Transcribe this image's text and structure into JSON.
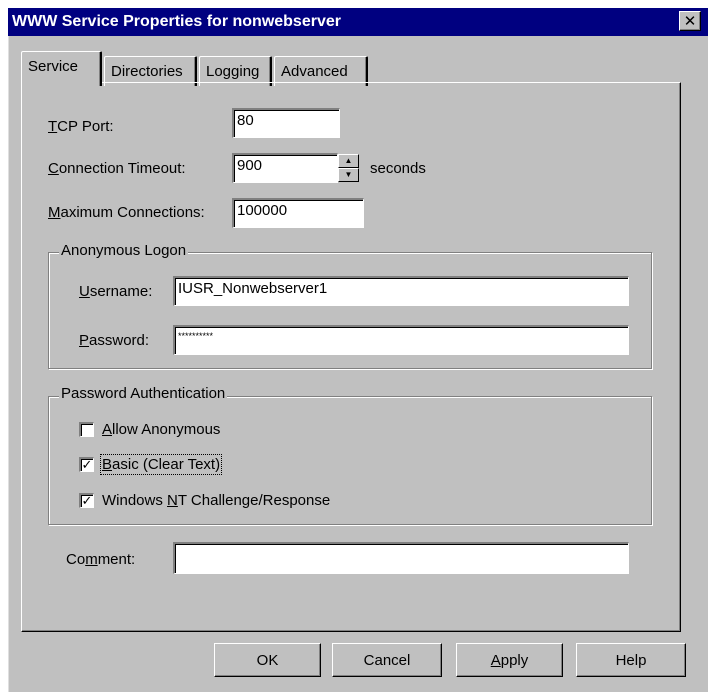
{
  "window": {
    "title": "WWW Service Properties for nonwebserver",
    "close_glyph": "✕"
  },
  "tabs": [
    {
      "label": "Service",
      "active": true
    },
    {
      "label": "Directories",
      "active": false
    },
    {
      "label": "Logging",
      "active": false
    },
    {
      "label": "Advanced",
      "active": false
    }
  ],
  "service": {
    "tcp_port": {
      "accel": "T",
      "rest": "CP Port:",
      "value": "80"
    },
    "connection_timeout": {
      "accel": "C",
      "rest": "onnection Timeout:",
      "value": "900",
      "unit": "seconds"
    },
    "max_connections": {
      "accel": "M",
      "rest": "aximum Connections:",
      "value": "100000"
    }
  },
  "anonymous_logon": {
    "title": "Anonymous Logon",
    "username": {
      "accel": "U",
      "rest": "sername:",
      "value": "IUSR_Nonwebserver1"
    },
    "password": {
      "accel": "P",
      "rest": "assword:",
      "value": "**********"
    }
  },
  "password_auth": {
    "title": "Password Authentication",
    "options": [
      {
        "pre": "",
        "accel": "A",
        "rest": "llow Anonymous",
        "checked": false,
        "mark": ""
      },
      {
        "pre": "",
        "accel": "B",
        "rest": "asic (Clear Text)",
        "checked": true,
        "mark": "✓"
      },
      {
        "pre": "Windows ",
        "accel": "N",
        "rest": "T Challenge/Response",
        "checked": true,
        "mark": "✓"
      }
    ]
  },
  "comment": {
    "pre": "Co",
    "accel": "m",
    "rest": "ment:",
    "value": ""
  },
  "buttons": {
    "ok": "OK",
    "cancel": "Cancel",
    "apply": {
      "accel": "A",
      "rest": "pply"
    },
    "help": "Help"
  }
}
